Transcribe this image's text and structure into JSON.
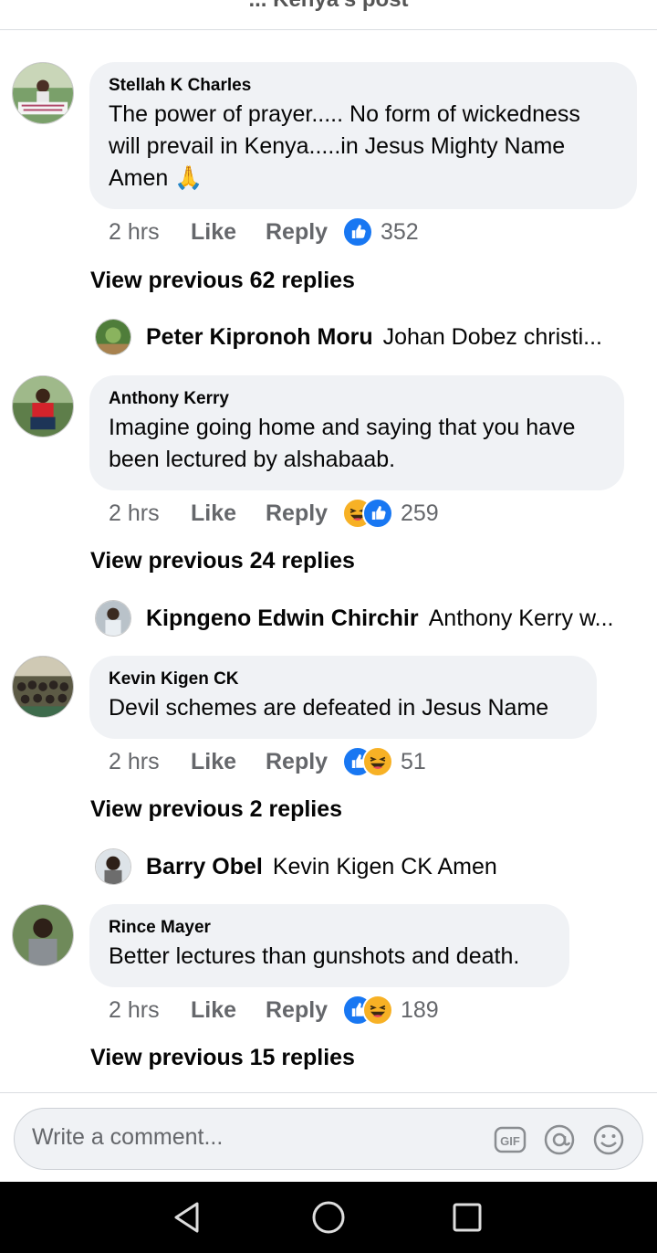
{
  "header": {
    "title": "... Kenya's post"
  },
  "comments": [
    {
      "author": "Stellah K Charles",
      "text": "The power of prayer..... No form of wickedness will prevail in Kenya.....in Jesus Mighty Name Amen 🙏",
      "time": "2 hrs",
      "like": "Like",
      "reply": "Reply",
      "reactions": [
        "like"
      ],
      "reaction_count": "352",
      "view_previous": "View previous 62 replies",
      "latest_reply": {
        "author": "Peter Kipronoh Moru",
        "text": "Johan Dobez christi..."
      }
    },
    {
      "author": "Anthony Kerry",
      "text": "Imagine going home and saying that you have been lectured by alshabaab.",
      "time": "2 hrs",
      "like": "Like",
      "reply": "Reply",
      "reactions": [
        "haha",
        "like"
      ],
      "reaction_count": "259",
      "view_previous": "View previous 24 replies",
      "latest_reply": {
        "author": "Kipngeno Edwin Chirchir",
        "text": "Anthony Kerry w..."
      }
    },
    {
      "author": "Kevin Kigen CK",
      "text": "Devil schemes are defeated in Jesus Name",
      "time": "2 hrs",
      "like": "Like",
      "reply": "Reply",
      "reactions": [
        "like",
        "haha"
      ],
      "reaction_count": "51",
      "view_previous": "View previous 2 replies",
      "latest_reply": {
        "author": "Barry Obel",
        "text": "Kevin Kigen CK Amen"
      }
    },
    {
      "author": "Rince Mayer",
      "text": "Better lectures than gunshots and death.",
      "time": "2 hrs",
      "like": "Like",
      "reply": "Reply",
      "reactions": [
        "like",
        "haha"
      ],
      "reaction_count": "189",
      "view_previous": "View previous 15 replies"
    }
  ],
  "composer": {
    "placeholder": "Write a comment...",
    "icons": [
      "gif-icon",
      "mention-icon",
      "emoji-icon"
    ]
  },
  "navbar": {
    "icons": [
      "back-icon",
      "home-icon",
      "recents-icon"
    ]
  },
  "colors": {
    "bubble": "#f0f2f5",
    "like_blue": "#1877f2",
    "haha_yellow": "#f7b125",
    "muted": "#65676b"
  }
}
